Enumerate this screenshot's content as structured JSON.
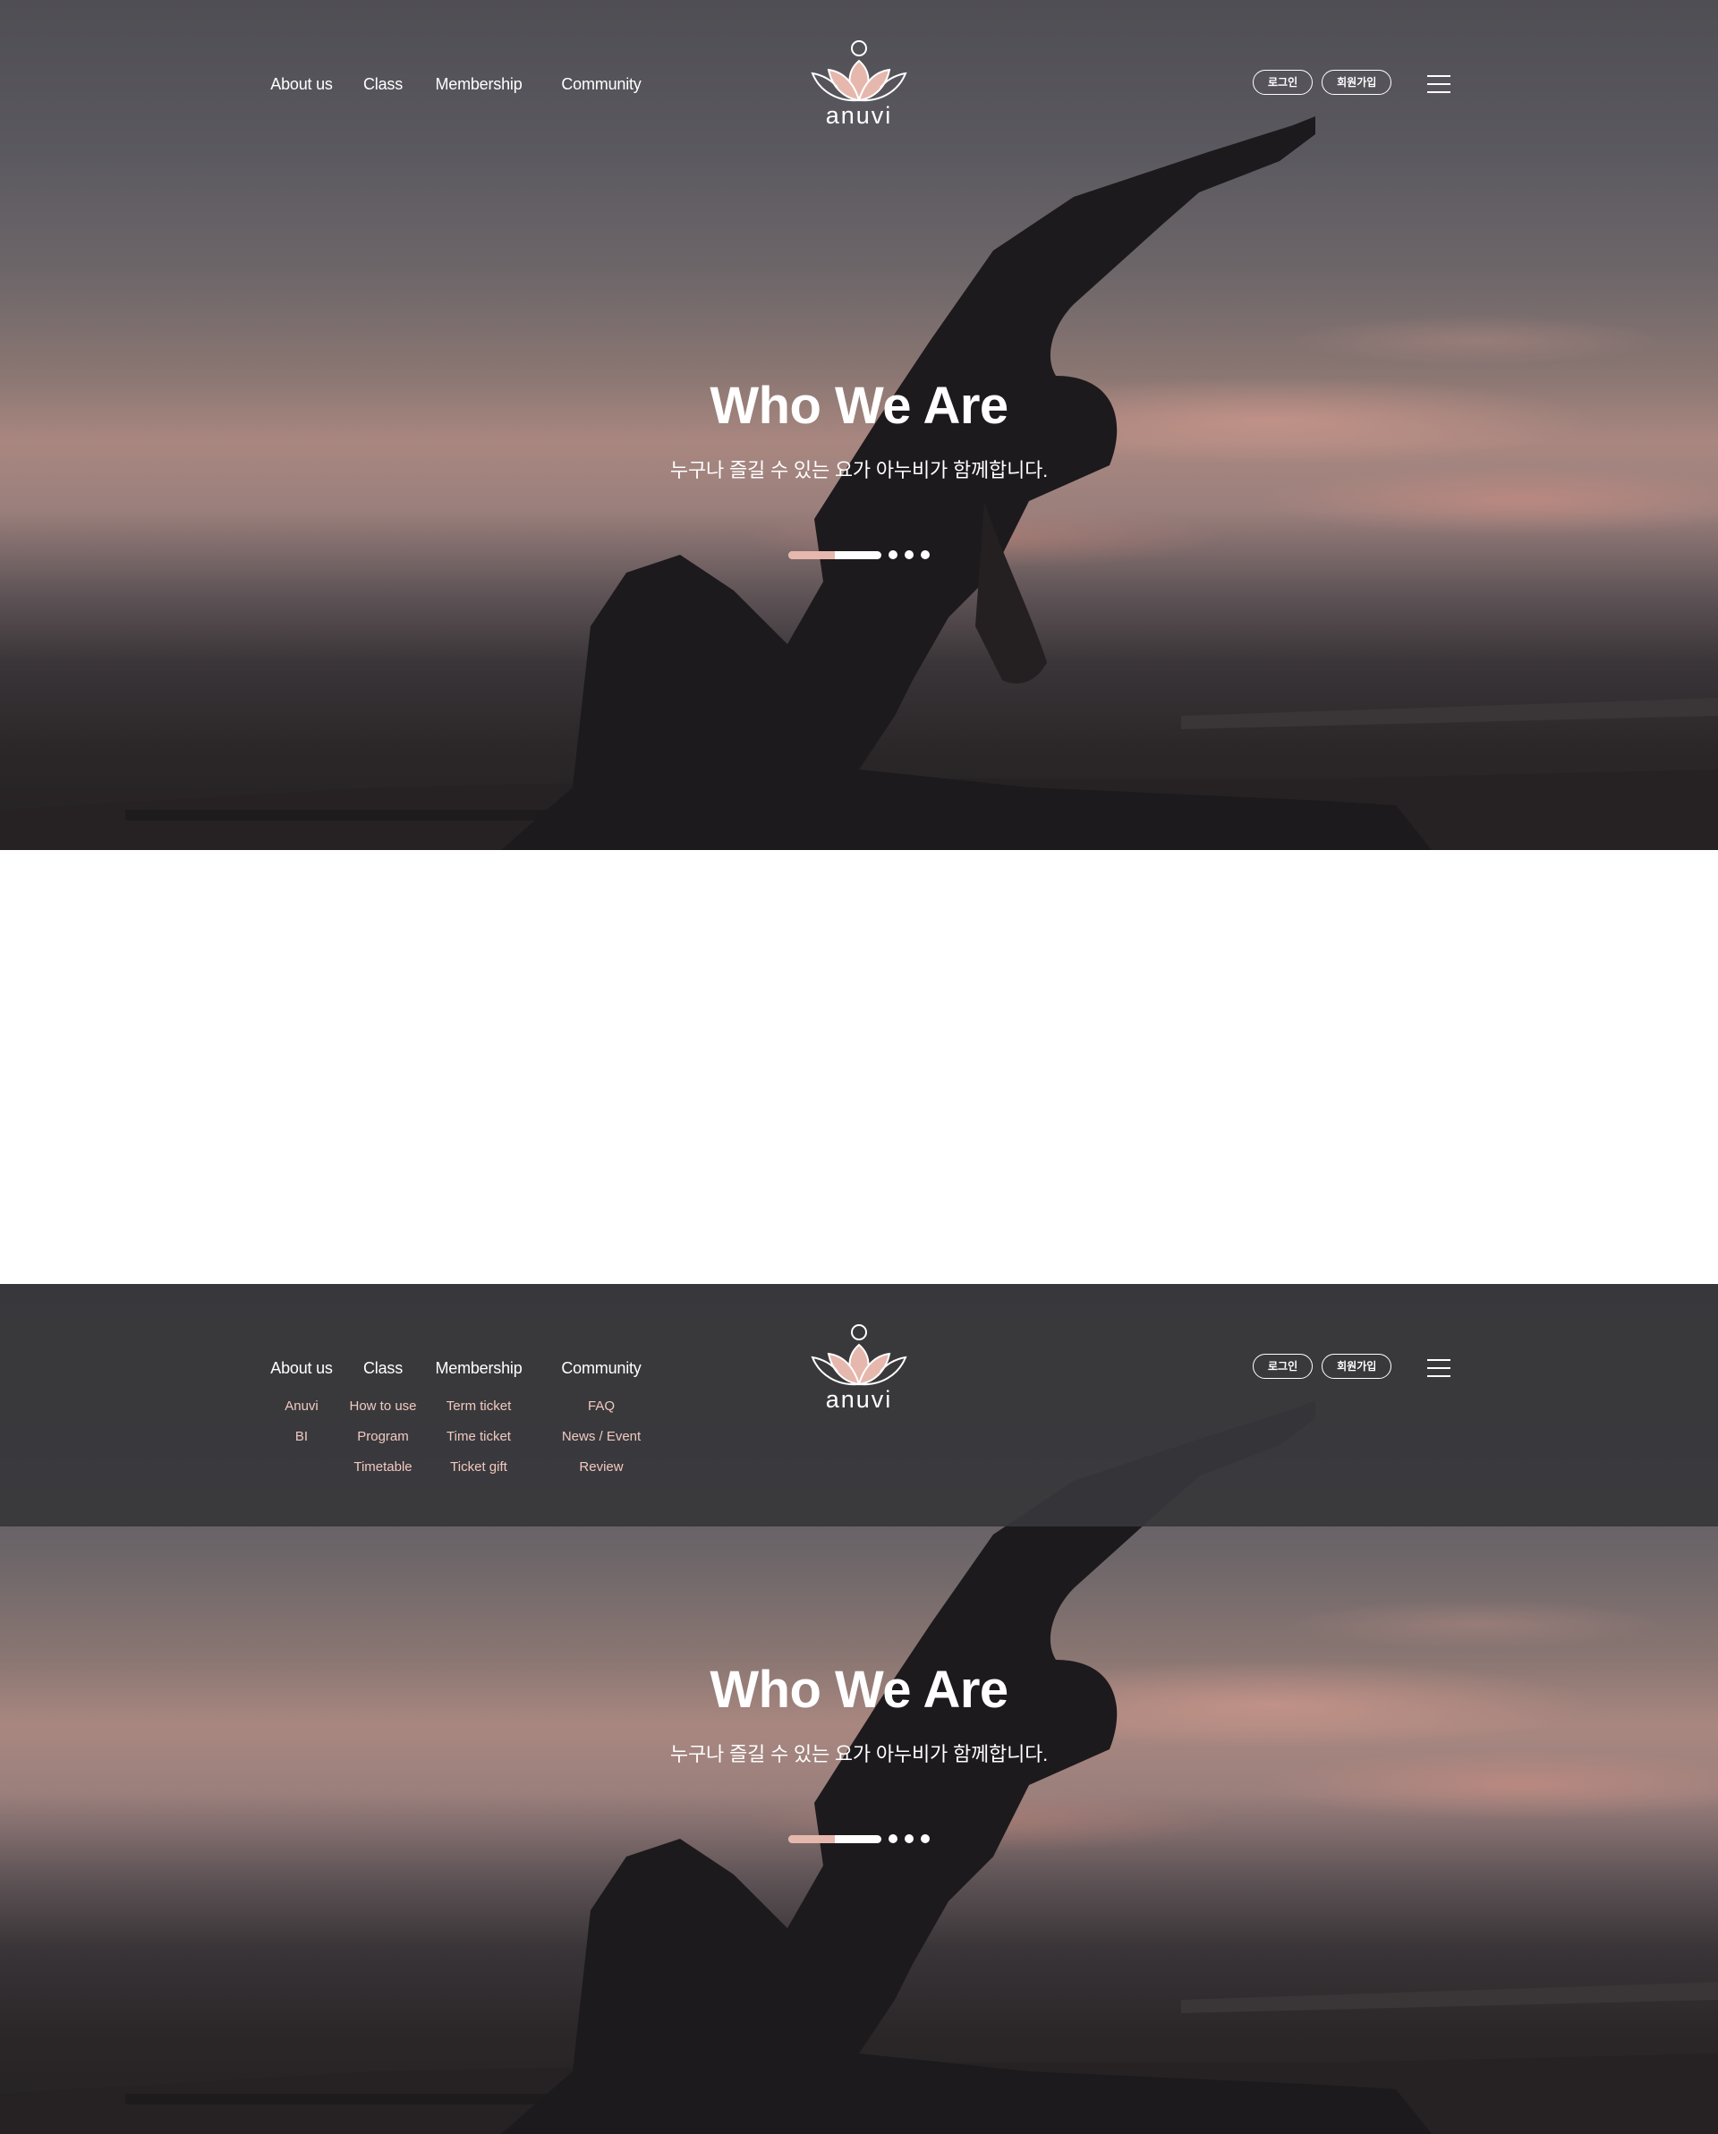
{
  "header": {
    "menu": [
      {
        "label": "About us",
        "sub": [
          "Anuvi",
          "BI"
        ]
      },
      {
        "label": "Class",
        "sub": [
          "How to use",
          "Program",
          "Timetable"
        ]
      },
      {
        "label": "Membership",
        "sub": [
          "Term ticket",
          "Time ticket",
          "Ticket gift"
        ]
      },
      {
        "label": "Community",
        "sub": [
          "FAQ",
          "News / Event",
          "Review"
        ]
      }
    ],
    "logo_text": "anuvi",
    "login_label": "로그인",
    "signup_label": "회원가입",
    "menu_icon": "hamburger-icon"
  },
  "hero": {
    "title": "Who We Are",
    "subtitle": "누구나 즐길 수 있는 요가 아누비가 함께합니다.",
    "slider": {
      "total_slides": 4,
      "progress": 0.5
    }
  },
  "colors": {
    "accent": "#e6b7ad",
    "submenu_text": "#f0c9c0",
    "dropdown_bg": "#37373a"
  }
}
